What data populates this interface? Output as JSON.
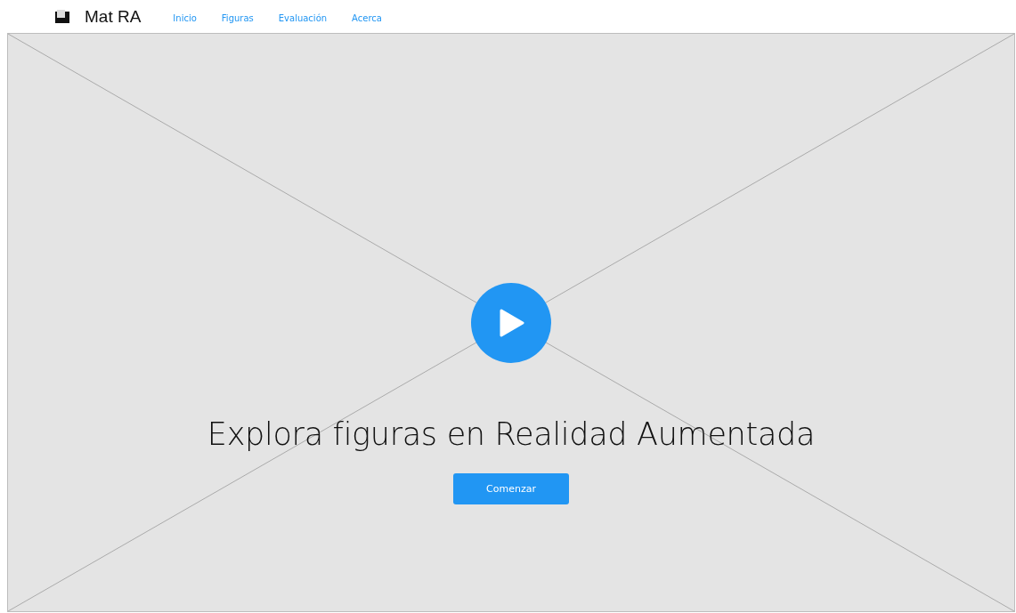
{
  "header": {
    "brand": "Mat RA",
    "nav": [
      {
        "label": "Inicio"
      },
      {
        "label": "Figuras"
      },
      {
        "label": "Evaluación"
      },
      {
        "label": "Acerca"
      }
    ]
  },
  "hero": {
    "title": "Explora figuras en Realidad Aumentada",
    "button": "Comenzar"
  }
}
